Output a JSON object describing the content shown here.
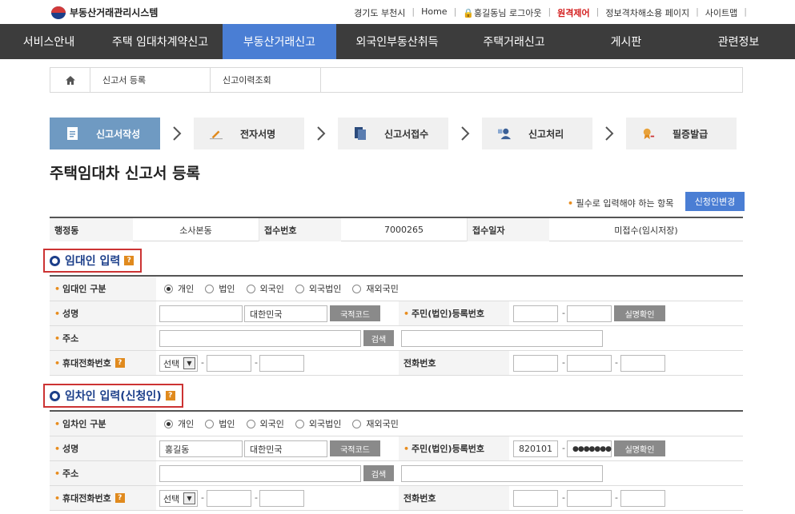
{
  "header": {
    "logo_text": "부동산거래관리시스템",
    "util_links": [
      "경기도 부천시",
      "Home",
      "홍길동님 로그아웃",
      "원격제어",
      "정보격차해소용 페이지",
      "사이트맵"
    ]
  },
  "gnb": [
    "서비스안내",
    "주택 임대차계약신고",
    "부동산거래신고",
    "외국인부동산취득",
    "주택거래신고",
    "게시판",
    "관련정보"
  ],
  "breadcrumb": [
    "신고서 등록",
    "신고이력조회"
  ],
  "steps": [
    "신고서작성",
    "전자서명",
    "신고서접수",
    "신고처리",
    "필증발급"
  ],
  "page_title": "주택임대차 신고서 등록",
  "required_note": "필수로 입력해야 하는 항목",
  "change_button": "신청인변경",
  "info": {
    "h1": "행정동",
    "v1": "소사본동",
    "h2": "접수번호",
    "v2": "7000265",
    "h3": "접수일자",
    "v3": "미접수(임시저장)"
  },
  "lessor": {
    "title": "임대인 입력",
    "type_label": "임대인 구분",
    "name_label": "성명",
    "name_value": "",
    "country": "대한민국",
    "country_btn": "국적코드",
    "id_label": "주민(법인)등록번호",
    "id1": "",
    "id2": "",
    "verify_btn": "실명확인",
    "addr_label": "주소",
    "search_btn": "검색",
    "mobile_label": "휴대전화번호",
    "select_value": "선택",
    "phone_label": "전화번호"
  },
  "lessee": {
    "title": "임차인 입력(신청인)",
    "type_label": "임차인 구분",
    "name_label": "성명",
    "name_value": "홍길동",
    "country": "대한민국",
    "country_btn": "국적코드",
    "id_label": "주민(법인)등록번호",
    "id1": "820101",
    "id2": "●●●●●●●",
    "verify_btn": "실명확인",
    "addr_label": "주소",
    "search_btn": "검색",
    "mobile_label": "휴대전화번호",
    "select_value": "선택",
    "phone_label": "전화번호"
  },
  "radio_options": [
    "개인",
    "법인",
    "외국인",
    "외국법인",
    "재외국민"
  ],
  "selected_type": "개인"
}
